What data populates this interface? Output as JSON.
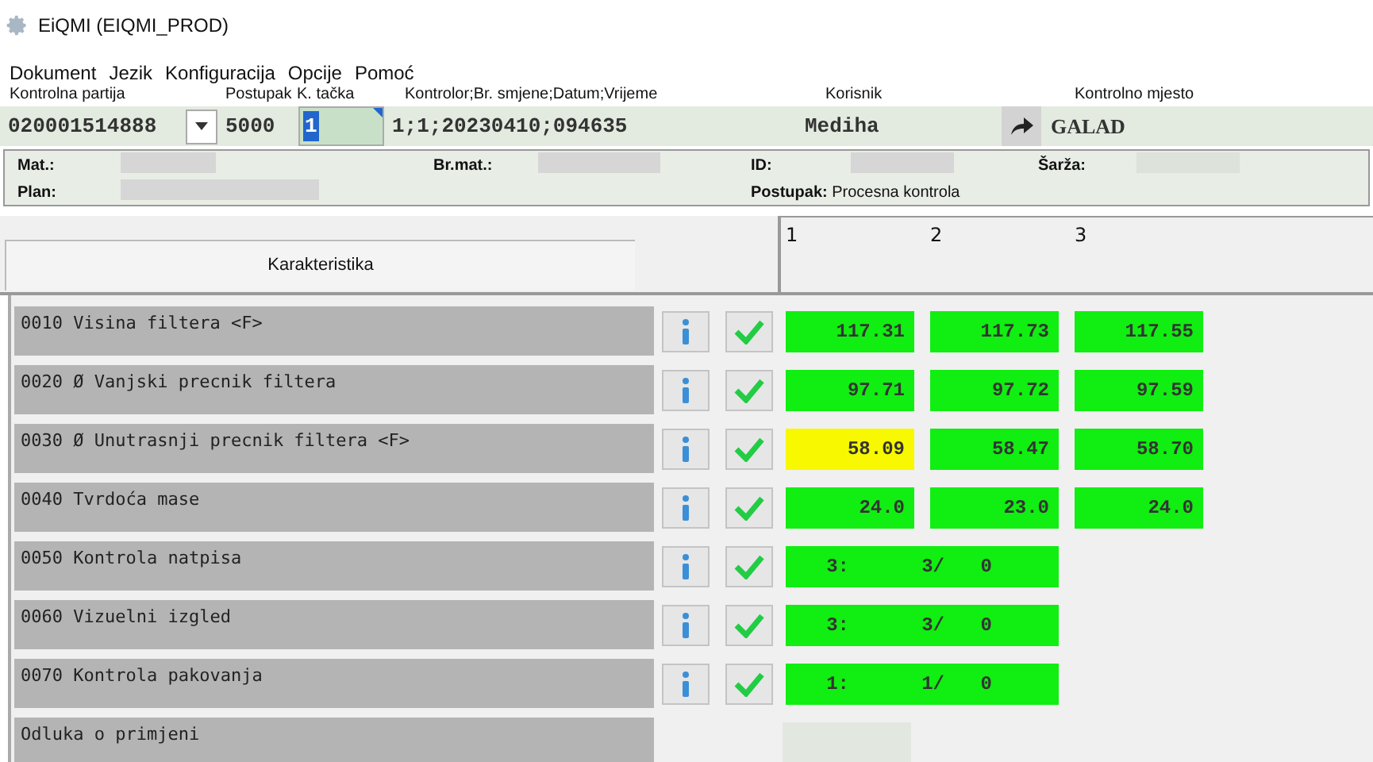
{
  "window": {
    "title": "EiQMI (EIQMI_PROD)"
  },
  "menu": [
    "Dokument",
    "Jezik",
    "Konfiguracija",
    "Opcije",
    "Pomoć"
  ],
  "lot": {
    "label": "Kontrolna partija",
    "value": "020001514888"
  },
  "procedure": {
    "label": "Postupak",
    "value": "5000"
  },
  "checkpoint": {
    "label": "K. tačka",
    "value": "1"
  },
  "controller": {
    "label": "Kontrolor;Br. smjene;Datum;Vrijeme",
    "value": "1;1;20230410;094635"
  },
  "user": {
    "label": "Korisnik",
    "value": "Mediha"
  },
  "location": {
    "label": "Kontrolno mjesto",
    "value": "GALAD"
  },
  "info": {
    "mat_label": "Mat.:",
    "br_mat_label": "Br.mat.:",
    "id_label": "ID:",
    "batch_label": "Šarža:",
    "plan_label": "Plan:",
    "procedure_label": "Postupak:",
    "procedure_value": "Procesna kontrola"
  },
  "table": {
    "columns": [
      "Karakteristika",
      "1",
      "2",
      "3"
    ],
    "rows": [
      {
        "kind": "measure",
        "label": "0010 Visina filtera <F>",
        "checked": true,
        "values": [
          {
            "text": "117.31",
            "color": "#11ee11"
          },
          {
            "text": "117.73",
            "color": "#11ee11"
          },
          {
            "text": "117.55",
            "color": "#11ee11"
          }
        ]
      },
      {
        "kind": "measure",
        "label": "0020 Ø Vanjski precnik filtera",
        "checked": true,
        "values": [
          {
            "text": "97.71",
            "color": "#11ee11"
          },
          {
            "text": "97.72",
            "color": "#11ee11"
          },
          {
            "text": "97.59",
            "color": "#11ee11"
          }
        ]
      },
      {
        "kind": "measure",
        "label": "0030 Ø Unutrasnji precnik filtera <F>",
        "checked": true,
        "values": [
          {
            "text": "58.09",
            "color": "#f8f800"
          },
          {
            "text": "58.47",
            "color": "#11ee11"
          },
          {
            "text": "58.70",
            "color": "#11ee11"
          }
        ]
      },
      {
        "kind": "measure",
        "label": "0040 Tvrdoća mase",
        "checked": true,
        "values": [
          {
            "text": "24.0",
            "color": "#11ee11"
          },
          {
            "text": "23.0",
            "color": "#11ee11"
          },
          {
            "text": "24.0",
            "color": "#11ee11"
          }
        ]
      },
      {
        "kind": "count",
        "label": "0050 Kontrola natpisa",
        "checked": true,
        "color": "#11ee11",
        "counts": [
          "3:",
          "3/",
          "0"
        ]
      },
      {
        "kind": "count",
        "label": "0060 Vizuelni izgled",
        "checked": true,
        "color": "#11ee11",
        "counts": [
          "3:",
          "3/",
          "0"
        ]
      },
      {
        "kind": "count",
        "label": "0070 Kontrola pakovanja",
        "checked": true,
        "color": "#11ee11",
        "counts": [
          "1:",
          "1/",
          "0"
        ]
      },
      {
        "kind": "decision",
        "label": "Odluka o primjeni"
      }
    ]
  }
}
